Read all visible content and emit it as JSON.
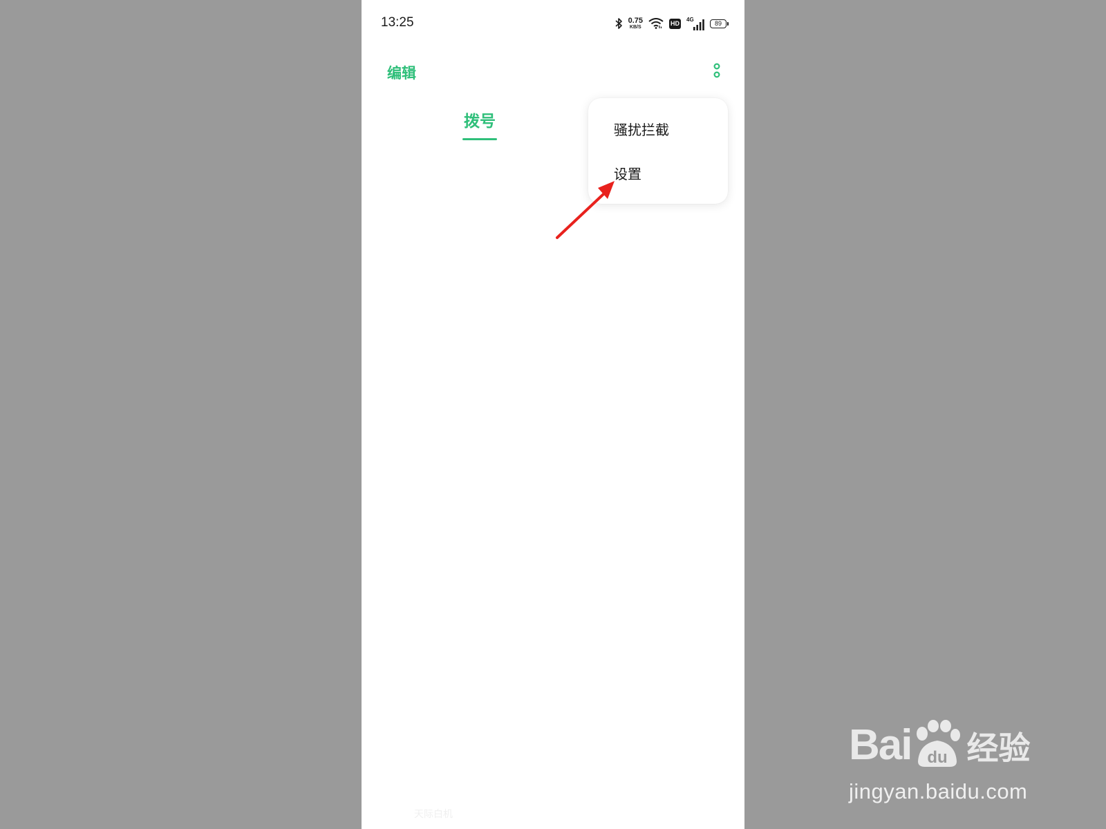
{
  "status_bar": {
    "time": "13:25",
    "net_speed_value": "0.75",
    "net_speed_unit": "KB/S",
    "hd_label": "HD",
    "network_gen": "4G",
    "battery": "89"
  },
  "toolbar": {
    "edit_label": "编辑",
    "more_icon": "more-vertical-icon"
  },
  "tabs": [
    {
      "label": "拨号",
      "active": true
    }
  ],
  "popup_menu": {
    "items": [
      {
        "label": "骚扰拦截"
      },
      {
        "label": "设置"
      }
    ]
  },
  "bottom_faint_text": "天际白机",
  "watermark": {
    "brand_latin": "Bai",
    "brand_du": "du",
    "brand_cn": "经验",
    "url": "jingyan.baidu.com"
  },
  "colors": {
    "accent": "#2fbf7a",
    "annotation_arrow": "#e8211d",
    "side_background": "#9a9a9a"
  }
}
